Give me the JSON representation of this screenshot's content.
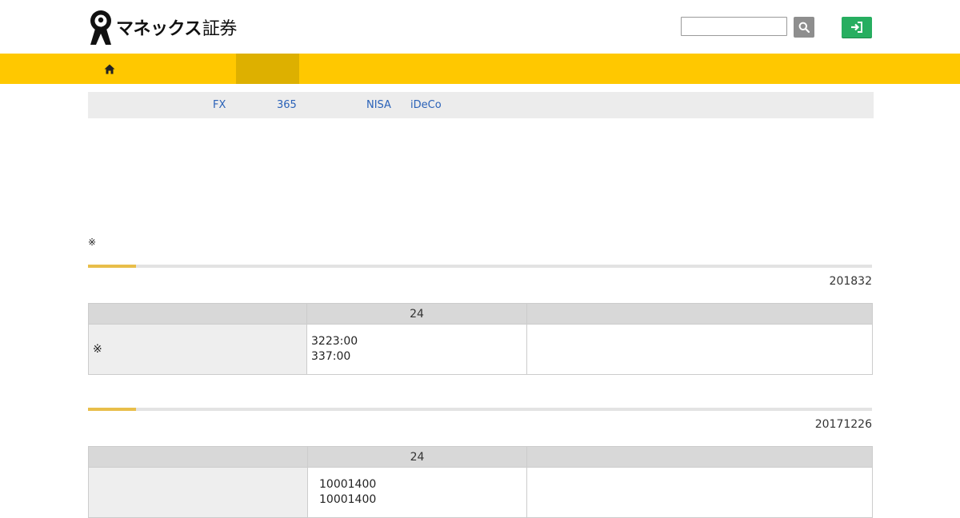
{
  "header": {
    "logo_main": "マネックス",
    "logo_sub": "証券",
    "search_placeholder": "",
    "search_icon": "search-icon",
    "login_icon": "login-icon"
  },
  "nav": {
    "home_icon": "home-icon",
    "color": "#ffc800",
    "active_color": "#ddb000"
  },
  "subnav": {
    "items": [
      "FX",
      "365",
      "NISA",
      "iDeCo"
    ],
    "link_color": "#2a62b8"
  },
  "note": "※",
  "sections": [
    {
      "date": "201832",
      "headers": [
        "",
        "24",
        ""
      ],
      "row_label": "※",
      "times": [
        "3223:00",
        "337:00"
      ],
      "extra": ""
    },
    {
      "date": "20171226",
      "headers": [
        "",
        "24",
        ""
      ],
      "row_label": "",
      "times": [
        "10001400",
        "10001400"
      ],
      "extra": ""
    }
  ]
}
